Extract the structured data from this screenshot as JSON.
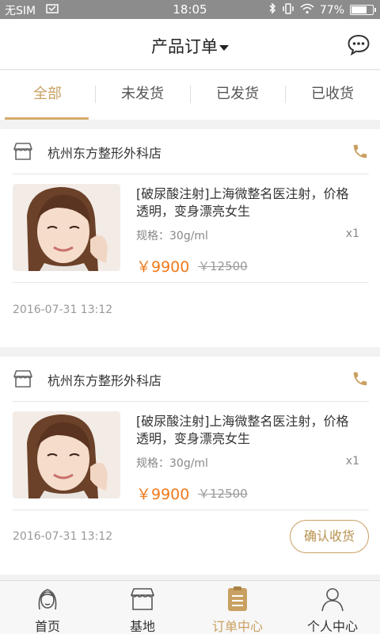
{
  "status_bar": {
    "carrier": "无SIM",
    "time": "18:05",
    "battery": "77%",
    "battery_level": 0.77
  },
  "header": {
    "title": "产品订单",
    "message_icon": "chat-bubble-icon"
  },
  "tabs": [
    {
      "label": "全部",
      "active": true
    },
    {
      "label": "未发货",
      "active": false
    },
    {
      "label": "已发货",
      "active": false
    },
    {
      "label": "已收货",
      "active": false
    }
  ],
  "orders": [
    {
      "shop_name": "杭州东方整形外科店",
      "product_title": "[破尿酸注射]上海微整名医注射，价格透明，变身漂亮女生",
      "spec": "规格：30g/ml",
      "qty": "x1",
      "price": "￥9900",
      "original_price": "￥12500",
      "time": "2016-07-31 13:12",
      "action": ""
    },
    {
      "shop_name": "杭州东方整形外科店",
      "product_title": "[破尿酸注射]上海微整名医注射，价格透明，变身漂亮女生",
      "spec": "规格：30g/ml",
      "qty": "x1",
      "price": "￥9900",
      "original_price": "￥12500",
      "time": "2016-07-31 13:12",
      "action": "确认收货"
    }
  ],
  "tabbar": [
    {
      "label": "首页",
      "icon": "face-icon",
      "active": false
    },
    {
      "label": "基地",
      "icon": "store-icon",
      "active": false
    },
    {
      "label": "订单中心",
      "icon": "order-list-icon",
      "active": true
    },
    {
      "label": "个人中心",
      "icon": "person-icon",
      "active": false
    }
  ],
  "colors": {
    "accent": "#c9a062",
    "price": "#f07a1c",
    "status_bar": "#8c8c8c"
  }
}
